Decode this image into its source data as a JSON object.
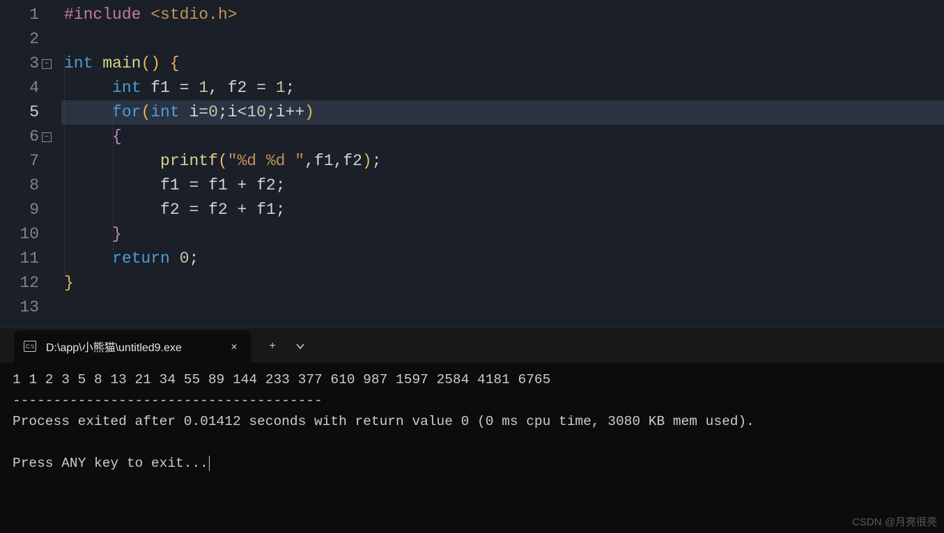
{
  "editor": {
    "line_numbers": [
      "1",
      "2",
      "3",
      "4",
      "5",
      "6",
      "7",
      "8",
      "9",
      "10",
      "11",
      "12",
      "13"
    ],
    "current_line": 5,
    "fold_lines": [
      3,
      6
    ],
    "code_lines": [
      {
        "tokens": [
          {
            "t": "#include ",
            "c": "pp"
          },
          {
            "t": "<stdio.h>",
            "c": "angle"
          }
        ]
      },
      {
        "tokens": []
      },
      {
        "raw": "int main() {",
        "tokens": [
          {
            "t": "int",
            "c": "type"
          },
          {
            "t": " ",
            "c": "id"
          },
          {
            "t": "main",
            "c": "fn"
          },
          {
            "t": "(",
            "c": "paren1"
          },
          {
            "t": ")",
            "c": "paren1"
          },
          {
            "t": " ",
            "c": "id"
          },
          {
            "t": "{",
            "c": "brace"
          }
        ]
      },
      {
        "indent": 1,
        "tokens": [
          {
            "t": "int",
            "c": "type"
          },
          {
            "t": " f1 ",
            "c": "id"
          },
          {
            "t": "=",
            "c": "op"
          },
          {
            "t": " ",
            "c": "id"
          },
          {
            "t": "1",
            "c": "num"
          },
          {
            "t": ", f2 ",
            "c": "id"
          },
          {
            "t": "=",
            "c": "op"
          },
          {
            "t": " ",
            "c": "id"
          },
          {
            "t": "1",
            "c": "num"
          },
          {
            "t": ";",
            "c": "punct"
          }
        ]
      },
      {
        "indent": 1,
        "highlight": true,
        "tokens": [
          {
            "t": "for",
            "c": "kw"
          },
          {
            "t": "(",
            "c": "paren1"
          },
          {
            "t": "int",
            "c": "type"
          },
          {
            "t": " i",
            "c": "id"
          },
          {
            "t": "=",
            "c": "op"
          },
          {
            "t": "0",
            "c": "num"
          },
          {
            "t": ";i",
            "c": "id"
          },
          {
            "t": "<",
            "c": "op"
          },
          {
            "t": "10",
            "c": "num"
          },
          {
            "t": ";i",
            "c": "id"
          },
          {
            "t": "++",
            "c": "op"
          },
          {
            "t": ")",
            "c": "paren1"
          }
        ]
      },
      {
        "indent": 1,
        "tokens": [
          {
            "t": "{",
            "c": "paren2"
          }
        ]
      },
      {
        "indent": 2,
        "tokens": [
          {
            "t": "printf",
            "c": "fn"
          },
          {
            "t": "(",
            "c": "paren1"
          },
          {
            "t": "\"%d %d \"",
            "c": "str"
          },
          {
            "t": ",f1,f2",
            "c": "id"
          },
          {
            "t": ")",
            "c": "paren1"
          },
          {
            "t": ";",
            "c": "punct"
          }
        ]
      },
      {
        "indent": 2,
        "tokens": [
          {
            "t": "f1 ",
            "c": "id"
          },
          {
            "t": "=",
            "c": "op"
          },
          {
            "t": " f1 ",
            "c": "id"
          },
          {
            "t": "+",
            "c": "op"
          },
          {
            "t": " f2",
            "c": "id"
          },
          {
            "t": ";",
            "c": "punct"
          }
        ]
      },
      {
        "indent": 2,
        "tokens": [
          {
            "t": "f2 ",
            "c": "id"
          },
          {
            "t": "=",
            "c": "op"
          },
          {
            "t": " f2 ",
            "c": "id"
          },
          {
            "t": "+",
            "c": "op"
          },
          {
            "t": " f1",
            "c": "id"
          },
          {
            "t": ";",
            "c": "punct"
          }
        ]
      },
      {
        "indent": 1,
        "tokens": [
          {
            "t": "}",
            "c": "paren2"
          }
        ]
      },
      {
        "indent": 1,
        "tokens": [
          {
            "t": "return",
            "c": "kw"
          },
          {
            "t": " ",
            "c": "id"
          },
          {
            "t": "0",
            "c": "num"
          },
          {
            "t": ";",
            "c": "punct"
          }
        ]
      },
      {
        "tokens": [
          {
            "t": "}",
            "c": "brace"
          }
        ]
      },
      {
        "tokens": []
      }
    ]
  },
  "terminal": {
    "tab_title": "D:\\app\\小熊猫\\untitled9.exe",
    "output_line1": "1 1 2 3 5 8 13 21 34 55 89 144 233 377 610 987 1597 2584 4181 6765",
    "separator": "--------------------------------------",
    "exit_msg": "Process exited after 0.01412 seconds with return value 0 (0 ms cpu time, 3080 KB mem used).",
    "prompt": "Press ANY key to exit..."
  },
  "watermark": "CSDN @月亮很亮"
}
